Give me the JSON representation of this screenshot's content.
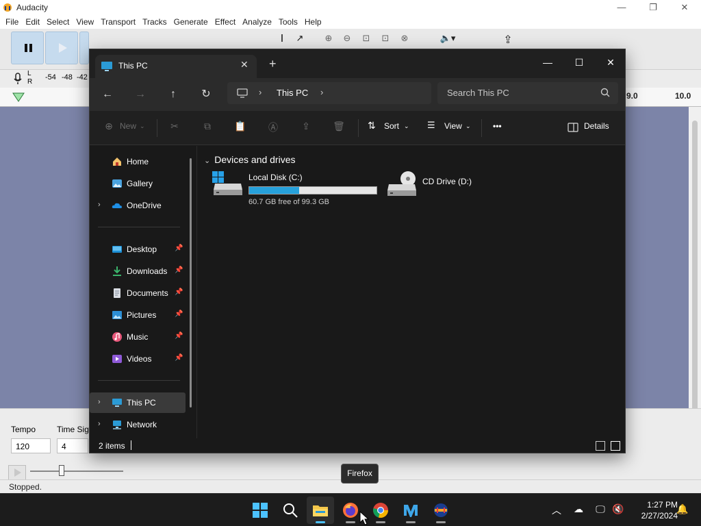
{
  "audacity": {
    "title": "Audacity",
    "menu": [
      "File",
      "Edit",
      "Select",
      "View",
      "Transport",
      "Tracks",
      "Generate",
      "Effect",
      "Analyze",
      "Tools",
      "Help"
    ],
    "meter": {
      "l": "L",
      "r": "R",
      "ticks": [
        "-54",
        "-48",
        "-42"
      ]
    },
    "ruler_right": [
      "9.0",
      "10.0"
    ],
    "tempo_label": "Tempo",
    "tempo_value": "120",
    "timesig_label": "Time Sig",
    "timesig_value": "4",
    "status": "Stopped."
  },
  "explorer": {
    "tab_title": "This PC",
    "new_tab": "+",
    "breadcrumb": "This PC",
    "search_placeholder": "Search This PC",
    "commands": {
      "new": "New",
      "sort": "Sort",
      "view": "View",
      "more": "•••",
      "details": "Details"
    },
    "sidebar": [
      {
        "label": "Home",
        "icon": "home-icon"
      },
      {
        "label": "Gallery",
        "icon": "gallery-icon"
      },
      {
        "label": "OneDrive",
        "icon": "onedrive-icon"
      },
      {
        "label": "Desktop",
        "icon": "desktop-icon"
      },
      {
        "label": "Downloads",
        "icon": "downloads-icon"
      },
      {
        "label": "Documents",
        "icon": "documents-icon"
      },
      {
        "label": "Pictures",
        "icon": "pictures-icon"
      },
      {
        "label": "Music",
        "icon": "music-icon"
      },
      {
        "label": "Videos",
        "icon": "videos-icon"
      },
      {
        "label": "This PC",
        "icon": "this-pc-icon"
      },
      {
        "label": "Network",
        "icon": "network-icon"
      }
    ],
    "section_title": "Devices and drives",
    "drives": [
      {
        "name": "Local Disk (C:)",
        "free": "60.7 GB free of 99.3 GB",
        "used_fraction": 0.39
      },
      {
        "name": "CD Drive (D:)"
      }
    ],
    "status_count": "2 items"
  },
  "tooltip": "Firefox",
  "taskbar": {
    "apps": [
      "start",
      "search",
      "file-explorer",
      "firefox",
      "chrome",
      "visual-studio-code",
      "audacity"
    ],
    "time": "1:27 PM",
    "date": "2/27/2024"
  },
  "colors": {
    "accent": "#4cc2ff",
    "drive_fill": "#26a0da",
    "audacity_track_bg": "#7c84a8"
  }
}
